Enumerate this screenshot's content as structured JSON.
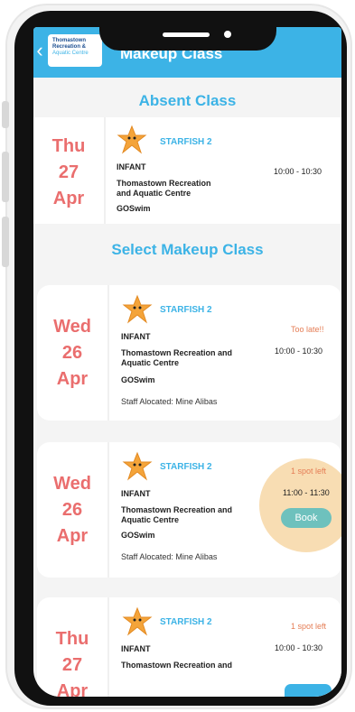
{
  "header": {
    "logo_line1": "Thomastown",
    "logo_line2": "Recreation &",
    "logo_line3": "Aquatic Centre",
    "title": "Makeup Class"
  },
  "absent": {
    "heading": "Absent Class",
    "day": "Thu",
    "date": "27",
    "month": "Apr",
    "level": "STARFISH 2",
    "age_group": "INFANT",
    "venue_line1": "Thomastown Recreation",
    "venue_line2": "and Aquatic Centre",
    "provider": "GOSwim",
    "time": "10:00 - 10:30"
  },
  "makeup_heading": "Select Makeup Class",
  "classes": [
    {
      "day": "Wed",
      "date": "26",
      "month": "Apr",
      "level": "STARFISH 2",
      "age_group": "INFANT",
      "venue_line1": "Thomastown Recreation and",
      "venue_line2": "Aquatic Centre",
      "provider": "GOSwim",
      "staff": "Staff Alocated: Mine Alibas",
      "status": "Too late!!",
      "time": "10:00 - 10:30"
    },
    {
      "day": "Wed",
      "date": "26",
      "month": "Apr",
      "level": "STARFISH 2",
      "age_group": "INFANT",
      "venue_line1": "Thomastown Recreation and",
      "venue_line2": "Aquatic Centre",
      "provider": "GOSwim",
      "staff": "Staff Alocated: Mine Alibas",
      "status": "1 spot left",
      "time": "11:00 - 11:30",
      "button": "Book"
    },
    {
      "day": "Thu",
      "date": "27",
      "month": "Apr",
      "level": "STARFISH 2",
      "age_group": "INFANT",
      "venue_line1": "Thomastown Recreation and",
      "status": "1 spot left",
      "time": "10:00 - 10:30"
    }
  ],
  "colors": {
    "accent": "#3cb3e6",
    "date": "#ea6e6e",
    "status": "#e57d55",
    "book": "#6ec1bd",
    "highlight": "#f4c680"
  }
}
